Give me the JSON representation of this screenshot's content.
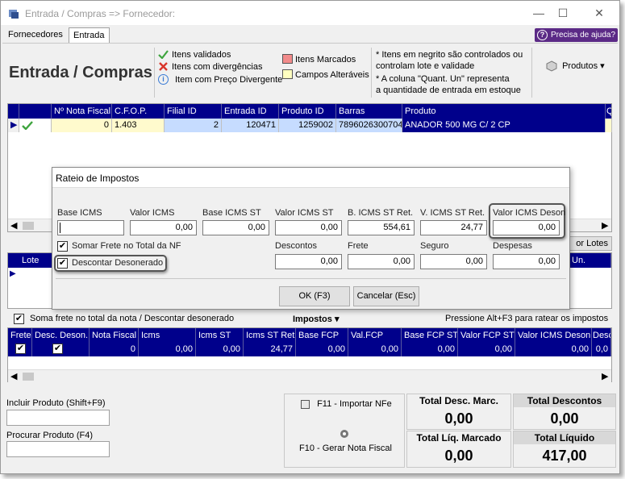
{
  "window": {
    "title": "Entrada / Compras => Fornecedor:",
    "minimize": "—",
    "maximize": "☐",
    "close": "✕"
  },
  "tabs": [
    {
      "label": "Fornecedores"
    },
    {
      "label": "Entrada"
    }
  ],
  "help": {
    "label": "Precisa de ajuda?",
    "icon": "?"
  },
  "header": {
    "title": "Entrada / Compras",
    "legend": {
      "validated": "Itens validados",
      "divergent": "Itens com divergências",
      "price_divergent": "Item com Preço Divergente",
      "marked": "Itens Marcados",
      "changed_fields": "Campos Alteráveis"
    },
    "notes": {
      "line1": "* Itens em negrito são controlados ou",
      "line2": "controlam lote e validade",
      "line3": "* A coluna \"Quant. Un\" representa",
      "line4": "a quantidade de entrada em estoque"
    },
    "products_button": "Produtos"
  },
  "items_grid": {
    "columns": [
      "Nº Nota Fiscal",
      "C.F.O.P.",
      "Filial ID",
      "Entrada ID",
      "Produto ID",
      "Barras",
      "Produto",
      "Q"
    ],
    "rows": [
      {
        "nota": "0",
        "cfop": "1.403",
        "filial": "2",
        "entrada": "120471",
        "produto_id": "1259002",
        "barras": "7896026300704",
        "produto": "ANADOR 500 MG C/ 2 CP"
      }
    ]
  },
  "lote_grid": {
    "col_lote": "Lote",
    "col_un": "Un.",
    "lotes_button": "or Lotes"
  },
  "dialog": {
    "title": "Rateio de Impostos",
    "fields": {
      "base_icms": {
        "label": "Base ICMS",
        "value": ""
      },
      "valor_icms": {
        "label": "Valor ICMS",
        "value": "0,00"
      },
      "base_icms_st": {
        "label": "Base ICMS ST",
        "value": "0,00"
      },
      "valor_icms_st": {
        "label": "Valor ICMS ST",
        "value": "0,00"
      },
      "b_icms_st_ret": {
        "label": "B. ICMS ST Ret.",
        "value": "554,61"
      },
      "v_icms_st_ret": {
        "label": "V. ICMS ST Ret.",
        "value": "24,77"
      },
      "valor_icms_deson": {
        "label": "Valor ICMS Deson",
        "value": "0,00"
      },
      "descontos": {
        "label": "Descontos",
        "value": "0,00"
      },
      "frete": {
        "label": "Frete",
        "value": "0,00"
      },
      "seguro": {
        "label": "Seguro",
        "value": "0,00"
      },
      "despesas": {
        "label": "Despesas",
        "value": "0,00"
      }
    },
    "check_frete": {
      "label": "Somar Frete no Total da NF",
      "checked": true
    },
    "check_desonerado": {
      "label": "Descontar Desonerado",
      "checked": true
    },
    "ok_button": "OK (F3)",
    "cancel_button": "Cancelar (Esc)"
  },
  "taxes_bar": {
    "check_label": "Soma frete no total da nota / Descontar desonerado",
    "impostos": "Impostos",
    "hint": "Pressione Alt+F3 para ratear os impostos"
  },
  "tax_grid": {
    "columns": [
      "Frete",
      "Desc. Deson.",
      "Nota Fiscal",
      "Icms",
      "Icms ST",
      "Icms ST Ret",
      "Base FCP",
      "Val.FCP",
      "Base FCP ST",
      "Valor FCP ST",
      "Valor ICMS Deson.",
      "Desc"
    ],
    "row": [
      "",
      "",
      "0",
      "0,00",
      "0,00",
      "24,77",
      "0,00",
      "0,00",
      "0,00",
      "0,00",
      "0,00",
      "0,0"
    ]
  },
  "bottom": {
    "include_label": "Incluir Produto (Shift+F9)",
    "search_label": "Procurar Produto (F4)",
    "import_nfe": "F11 - Importar NFe",
    "gerar_nota": "F10 - Gerar Nota Fiscal",
    "totals": {
      "desc_marc_label": "Total Desc. Marc.",
      "desc_marc_value": "0,00",
      "descontos_label": "Total Descontos",
      "descontos_value": "0,00",
      "liq_marcado_label": "Total Líq. Marcado",
      "liq_marcado_value": "0,00",
      "liquido_label": "Total Líquido",
      "liquido_value": "417,00"
    }
  },
  "colors": {
    "grid_header": "#00008b",
    "selected_row": "#00008b",
    "help_button": "#5b2a86",
    "highlight_cell": "#fffacd",
    "blue_cell": "#c6dcff"
  }
}
